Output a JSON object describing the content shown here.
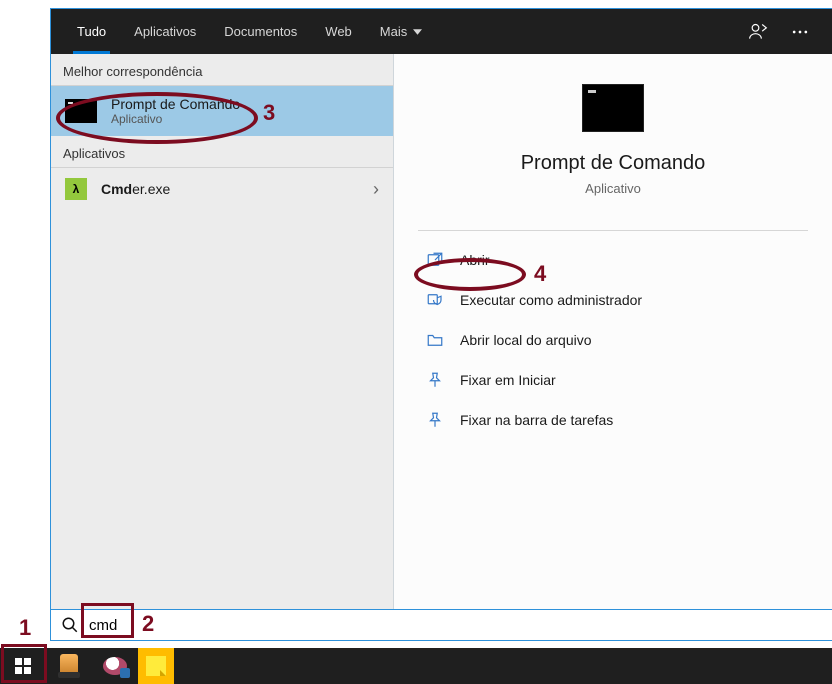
{
  "tabs": {
    "all": "Tudo",
    "apps": "Aplicativos",
    "documents": "Documentos",
    "web": "Web",
    "more": "Mais"
  },
  "sections": {
    "best_match": "Melhor correspondência",
    "apps": "Aplicativos"
  },
  "best_match": {
    "title": "Prompt de Comando",
    "subtitle": "Aplicativo"
  },
  "other_app": {
    "bold_prefix": "Cmd",
    "rest": "er.exe"
  },
  "preview": {
    "title": "Prompt de Comando",
    "subtitle": "Aplicativo"
  },
  "actions": {
    "open": "Abrir",
    "run_admin": "Executar como administrador",
    "open_location": "Abrir local do arquivo",
    "pin_start": "Fixar em Iniciar",
    "pin_taskbar": "Fixar na barra de tarefas"
  },
  "search": {
    "value": "cmd"
  },
  "annotations": {
    "n1": "1",
    "n2": "2",
    "n3": "3",
    "n4": "4"
  }
}
